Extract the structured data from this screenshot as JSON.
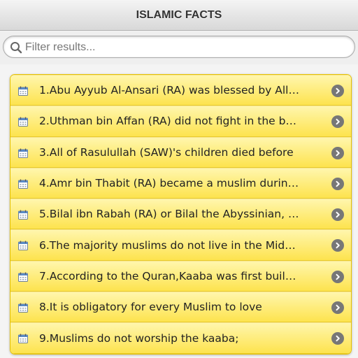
{
  "header": {
    "title": "ISLAMIC FACTS"
  },
  "filter": {
    "placeholder": "Filter results...",
    "icon": "search-icon"
  },
  "list": {
    "item_icon": "calendar-icon",
    "arrow_icon": "chevron-right-icon",
    "items": [
      {
        "label": "1.Abu Ayyub Al-Ansari (RA) was blessed by Allah"
      },
      {
        "label": "2.Uthman bin Affan (RA) did not fight in the battle"
      },
      {
        "label": "3.All of Rasulullah (SAW)'s children died before"
      },
      {
        "label": "4.Amr bin Thabit (RA) became a muslim during the"
      },
      {
        "label": "5.Bilal ibn Rabah (RA) or Bilal the Abyssinian, also"
      },
      {
        "label": "6.The majority muslims do not live in the Middle East"
      },
      {
        "label": "7.According to the Quran,Kaaba was first built by"
      },
      {
        "label": "8.It is obligatory for every Muslim to love"
      },
      {
        "label": "9.Muslims do not worship the kaaba;"
      }
    ]
  },
  "colors": {
    "item_top": "#fff6ad",
    "item_bottom": "#fde34e",
    "arrow": "#777777"
  }
}
